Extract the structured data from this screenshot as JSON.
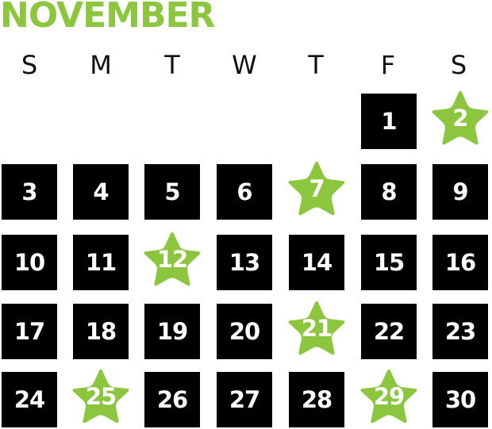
{
  "month": "NOVEMBER",
  "weekdays": [
    "S",
    "M",
    "T",
    "W",
    "T",
    "F",
    "S"
  ],
  "colors": {
    "accent": "#8cc63f",
    "cell": "#000000",
    "number": "#ffffff",
    "weekday": "#111111"
  },
  "days": [
    {
      "label": "1",
      "style": "box"
    },
    {
      "label": "2",
      "style": "star-icon"
    },
    {
      "label": "3",
      "style": "box"
    },
    {
      "label": "4",
      "style": "box"
    },
    {
      "label": "5",
      "style": "box"
    },
    {
      "label": "6",
      "style": "box"
    },
    {
      "label": "7",
      "style": "star-icon"
    },
    {
      "label": "8",
      "style": "box"
    },
    {
      "label": "9",
      "style": "box"
    },
    {
      "label": "10",
      "style": "box"
    },
    {
      "label": "11",
      "style": "box"
    },
    {
      "label": "12",
      "style": "star-icon"
    },
    {
      "label": "13",
      "style": "box"
    },
    {
      "label": "14",
      "style": "box"
    },
    {
      "label": "15",
      "style": "box"
    },
    {
      "label": "16",
      "style": "box"
    },
    {
      "label": "17",
      "style": "box"
    },
    {
      "label": "18",
      "style": "box"
    },
    {
      "label": "19",
      "style": "box"
    },
    {
      "label": "20",
      "style": "box"
    },
    {
      "label": "21",
      "style": "star-icon"
    },
    {
      "label": "22",
      "style": "box"
    },
    {
      "label": "23",
      "style": "box"
    },
    {
      "label": "24",
      "style": "box"
    },
    {
      "label": "25",
      "style": "star-icon"
    },
    {
      "label": "26",
      "style": "box"
    },
    {
      "label": "27",
      "style": "box"
    },
    {
      "label": "28",
      "style": "box"
    },
    {
      "label": "29",
      "style": "star-icon"
    },
    {
      "label": "30",
      "style": "box"
    }
  ]
}
